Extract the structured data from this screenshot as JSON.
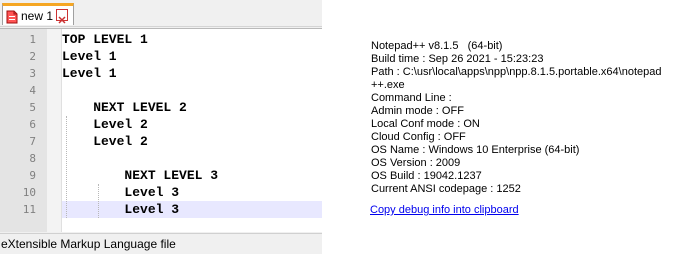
{
  "tab": {
    "label": "new 1",
    "icon": "unsaved-file-icon",
    "close_icon": "close-icon"
  },
  "editor": {
    "lines": [
      {
        "num": "1",
        "text": "TOP LEVEL 1"
      },
      {
        "num": "2",
        "text": "Level 1"
      },
      {
        "num": "3",
        "text": "Level 1"
      },
      {
        "num": "4",
        "text": ""
      },
      {
        "num": "5",
        "text": "    NEXT LEVEL 2"
      },
      {
        "num": "6",
        "text": "    Level 2"
      },
      {
        "num": "7",
        "text": "    Level 2"
      },
      {
        "num": "8",
        "text": ""
      },
      {
        "num": "9",
        "text": "        NEXT LEVEL 3"
      },
      {
        "num": "10",
        "text": "        Level 3"
      },
      {
        "num": "11",
        "text": "        Level 3"
      }
    ],
    "current_line": "11"
  },
  "status": {
    "file_type": "eXtensible Markup Language file"
  },
  "debug": {
    "lines": [
      "Notepad++ v8.1.5   (64-bit)",
      "Build time : Sep 26 2021 - 15:23:23",
      "Path : C:\\usr\\local\\apps\\npp\\npp.8.1.5.portable.x64\\notepad",
      "++.exe",
      "Command Line :",
      "Admin mode : OFF",
      "Local Conf mode : ON",
      "Cloud Config : OFF",
      "OS Name : Windows 10 Enterprise (64-bit)",
      "OS Version : 2009",
      "OS Build : 19042.1237",
      "Current ANSI codepage : 1252"
    ],
    "copy_link": "Copy debug info into clipboard"
  }
}
